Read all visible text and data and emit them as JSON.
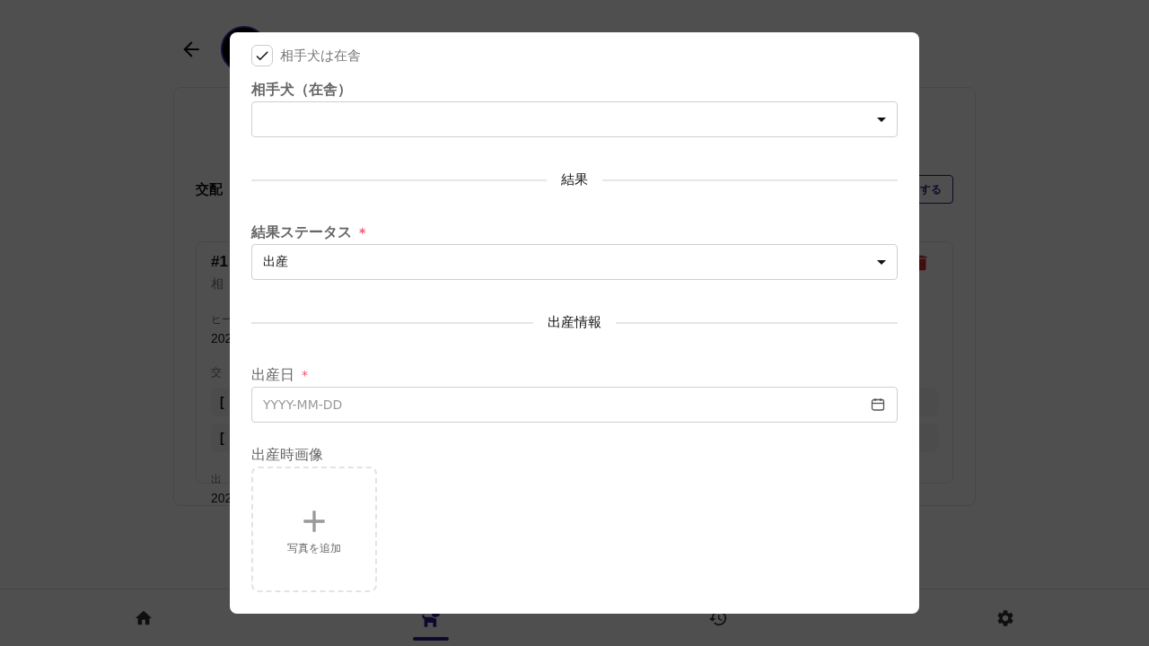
{
  "background_page": {
    "section_title": "交配",
    "action_button": "する",
    "card": {
      "lines": [
        {
          "kind": "title",
          "text": "#1"
        },
        {
          "kind": "subtitle",
          "text": "相"
        },
        {
          "kind": "label",
          "text": "ヒー"
        },
        {
          "kind": "value",
          "text": "202"
        },
        {
          "kind": "label",
          "text": "交"
        },
        {
          "kind": "entry",
          "text": "["
        },
        {
          "kind": "entry",
          "text": "["
        },
        {
          "kind": "label",
          "text": "出"
        },
        {
          "kind": "value",
          "text": "202"
        }
      ]
    }
  },
  "bottom_nav": [
    {
      "selected": false
    },
    {
      "selected": true
    },
    {
      "selected": false
    },
    {
      "selected": false
    }
  ],
  "dialog": {
    "fields": [
      {
        "kind": "checkbox",
        "label": "相手犬は在舎",
        "checked": true
      },
      {
        "kind": "select",
        "label": "相手犬（在舎）"
      },
      {
        "kind": "divider",
        "label": "結果"
      },
      {
        "kind": "select",
        "label": "結果ステータス",
        "required_mark": "*",
        "value": "出産"
      },
      {
        "kind": "divider",
        "label": "出産情報"
      },
      {
        "kind": "date",
        "label": "出産日",
        "required_mark": "*",
        "placeholder": "YYYY-MM-DD"
      },
      {
        "kind": "upload",
        "label": "出産時画像",
        "button": "写真を追加"
      }
    ]
  }
}
